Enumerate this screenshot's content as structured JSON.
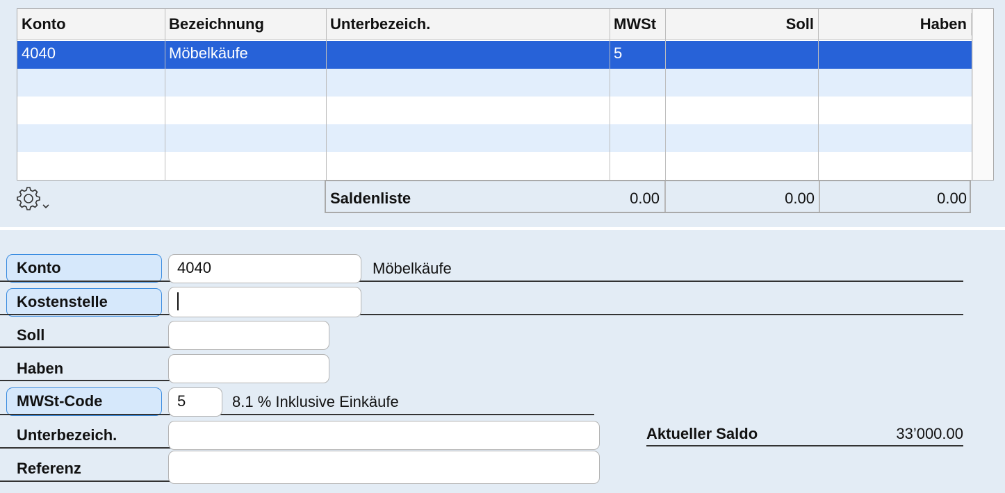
{
  "table": {
    "columns": [
      {
        "key": "konto",
        "label": "Konto"
      },
      {
        "key": "bezeichnung",
        "label": "Bezeichnung"
      },
      {
        "key": "unterbezeich",
        "label": "Unterbezeich."
      },
      {
        "key": "mwst",
        "label": "MWSt"
      },
      {
        "key": "soll",
        "label": "Soll"
      },
      {
        "key": "haben",
        "label": "Haben"
      }
    ],
    "rows": [
      {
        "konto": "4040",
        "bezeichnung": "Möbelkäufe",
        "unterbezeich": "",
        "mwst": "5",
        "soll": "",
        "haben": "",
        "selected": true
      },
      {
        "konto": "",
        "bezeichnung": "",
        "unterbezeich": "",
        "mwst": "",
        "soll": "",
        "haben": ""
      },
      {
        "konto": "",
        "bezeichnung": "",
        "unterbezeich": "",
        "mwst": "",
        "soll": "",
        "haben": ""
      },
      {
        "konto": "",
        "bezeichnung": "",
        "unterbezeich": "",
        "mwst": "",
        "soll": "",
        "haben": ""
      },
      {
        "konto": "",
        "bezeichnung": "",
        "unterbezeich": "",
        "mwst": "",
        "soll": "",
        "haben": ""
      }
    ],
    "totals": {
      "label": "Saldenliste",
      "mwst": "0.00",
      "soll": "0.00",
      "haben": "0.00"
    },
    "settings_icon": "gear-icon"
  },
  "form": {
    "konto": {
      "label": "Konto",
      "value": "4040",
      "description": "Möbelkäufe"
    },
    "kostenstelle": {
      "label": "Kostenstelle",
      "value": ""
    },
    "soll": {
      "label": "Soll",
      "value": ""
    },
    "haben": {
      "label": "Haben",
      "value": ""
    },
    "mwst_code": {
      "label": "MWSt-Code",
      "value": "5",
      "description": "8.1 % Inklusive Einkäufe"
    },
    "unterbezeich": {
      "label": "Unterbezeich.",
      "value": ""
    },
    "referenz": {
      "label": "Referenz",
      "value": ""
    },
    "aktueller_saldo": {
      "label": "Aktueller Saldo",
      "value": "33’000.00"
    }
  },
  "colors": {
    "selection": "#2762d8",
    "alt_row": "#e2eefc",
    "background": "#e3ecf5",
    "label_button": "#d6e8fb",
    "label_button_border": "#3a8ce0"
  }
}
